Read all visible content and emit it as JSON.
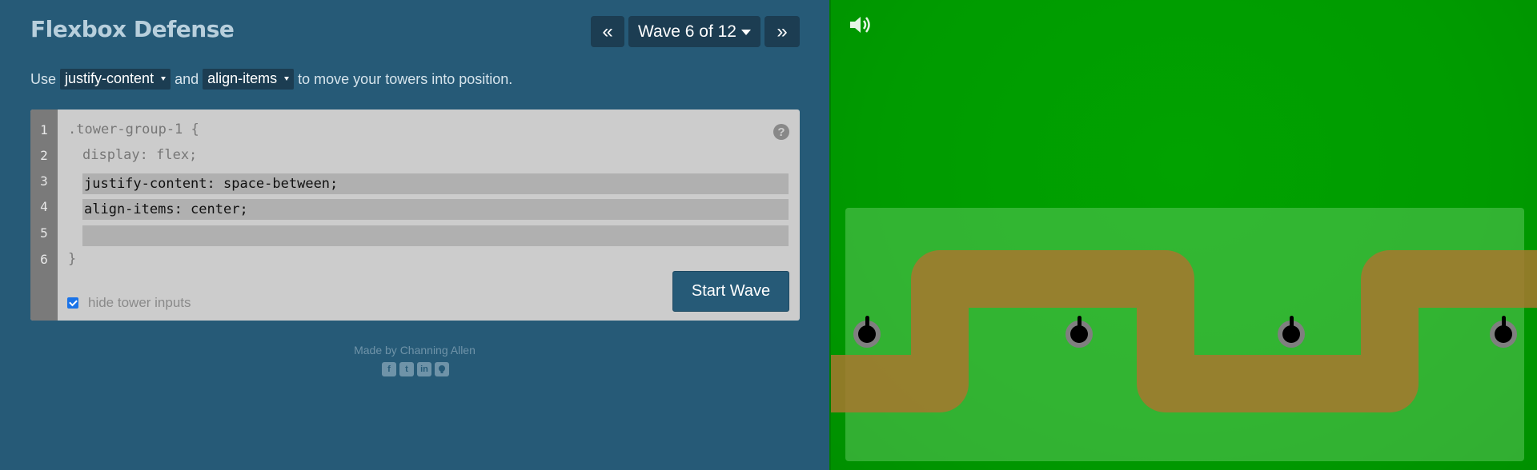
{
  "app": {
    "title": "Flexbox Defense"
  },
  "wave_nav": {
    "prev_label": "«",
    "current_label": "Wave 6 of 12",
    "next_label": "»",
    "current_wave": 6,
    "total_waves": 12
  },
  "instructions": {
    "prefix": "Use",
    "property_1": "justify-content",
    "joiner": "and",
    "property_2": "align-items",
    "suffix": "to move your towers into position."
  },
  "editor": {
    "line_numbers": [
      "1",
      "2",
      "3",
      "4",
      "5",
      "6"
    ],
    "line_1": ".tower-group-1 {",
    "line_2": "display: flex;",
    "input_1": "justify-content: space-between;",
    "input_2": "align-items: center;",
    "input_3": "",
    "line_6": "}",
    "help_label": "?",
    "start_button_label": "Start Wave",
    "hide_inputs_label": "hide tower inputs",
    "hide_inputs_checked": true
  },
  "footer": {
    "made_by": "Made by Channing Allen",
    "social_icons": [
      "facebook-icon",
      "twitter-icon",
      "linkedin-icon",
      "github-icon"
    ]
  },
  "board": {
    "tower_count": 4,
    "colors": {
      "grass": "#01a200",
      "field_overlay": "#6ed26e",
      "path": "#b07d44",
      "tower_base": "#7f7f7f",
      "tower_core": "#000000"
    }
  }
}
